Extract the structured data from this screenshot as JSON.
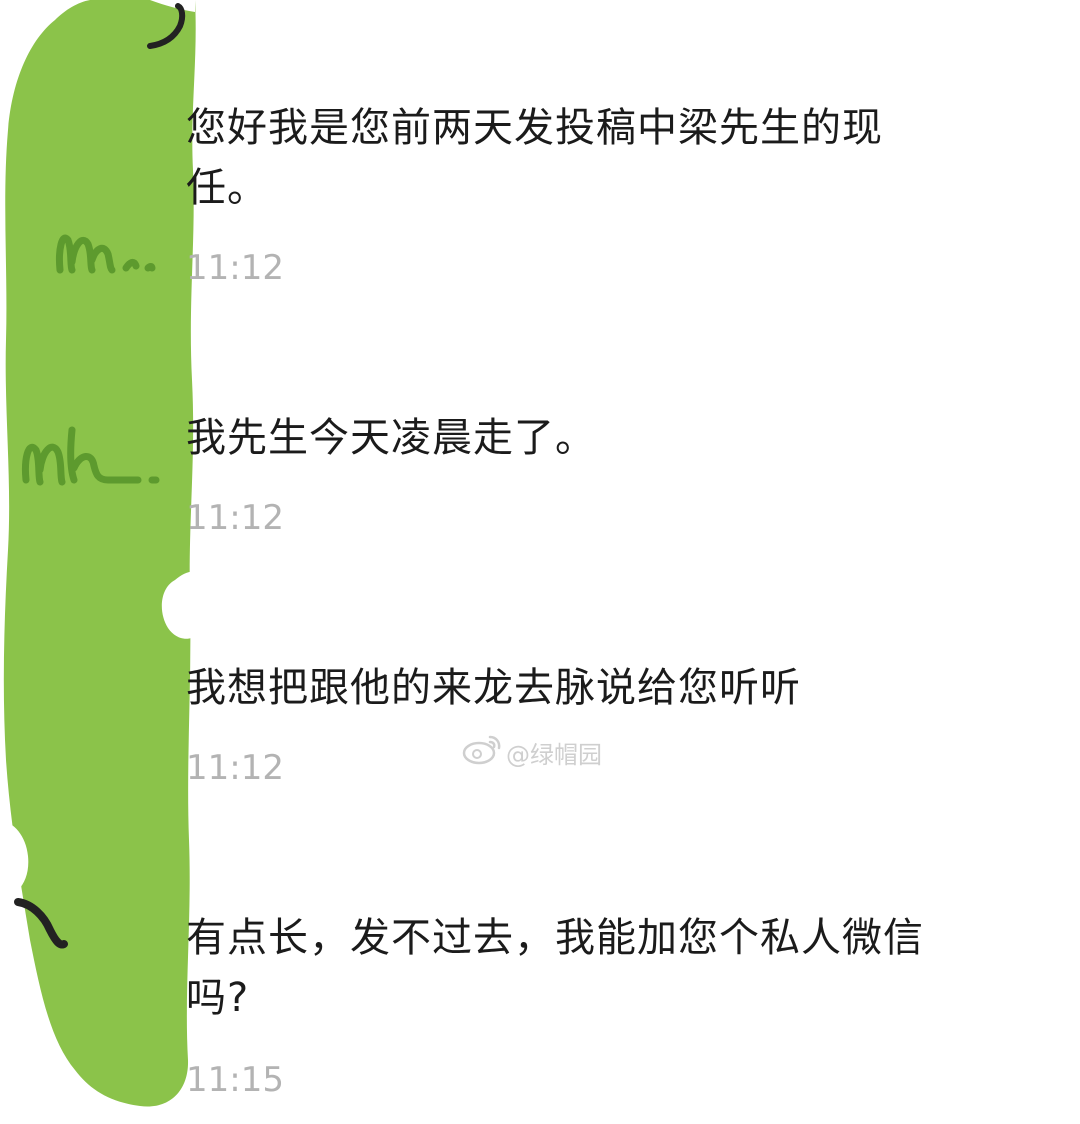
{
  "messages": [
    {
      "text": "您好我是您前两天发投稿中梁先生的现任。",
      "time": "11:12"
    },
    {
      "text": "我先生今天凌晨走了。",
      "time": "11:12"
    },
    {
      "text": "我想把跟他的来龙去脉说给您听听",
      "time": "11:12"
    },
    {
      "text": "有点长，发不过去，我能加您个私人微信吗?",
      "time": "11:15"
    }
  ],
  "watermark": {
    "icon": "weibo-icon",
    "text": "@绿帽园"
  },
  "colors": {
    "background": "#ffffff",
    "message_text": "#1b1b1b",
    "timestamp": "#b3b3b3",
    "redaction_green": "#8bc34a"
  }
}
